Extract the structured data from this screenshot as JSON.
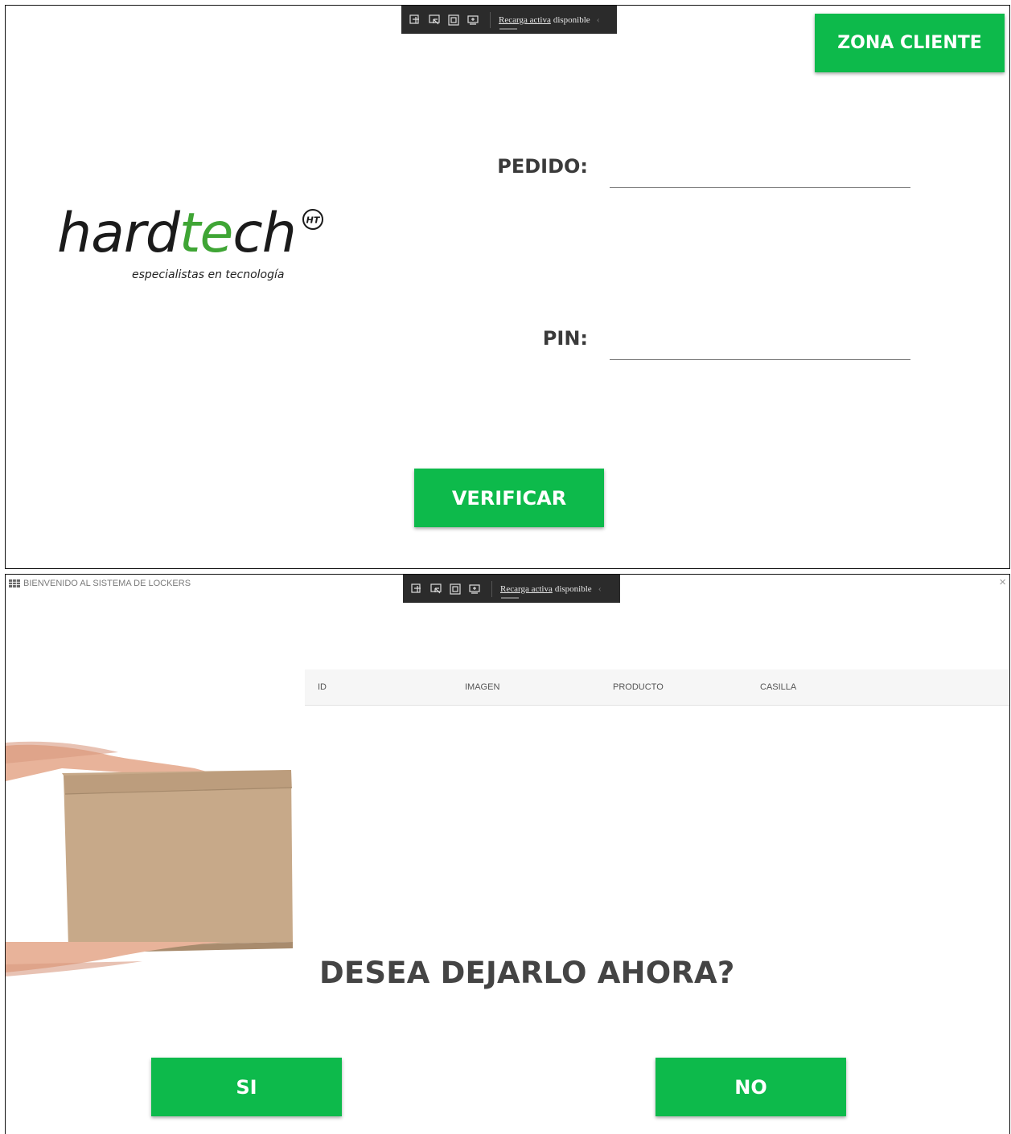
{
  "devtools_bar": {
    "link_text": "Recarga activa",
    "text": "disponible"
  },
  "login": {
    "zona_cliente_label": "ZONA CLIENTE",
    "pedido_label": "PEDIDO:",
    "pedido_value": "",
    "pin_label": "PIN:",
    "pin_value": "",
    "verificar_label": "VERIFICAR",
    "logo": {
      "word_dark": "hard",
      "word_green": "te",
      "word_end": "ch",
      "mark": "HT",
      "tagline": "especialistas en tecnología"
    }
  },
  "lockers": {
    "window_title": "BIENVENIDO AL SISTEMA DE LOCKERS",
    "close_label": "×",
    "table": {
      "columns": [
        "ID",
        "IMAGEN",
        "PRODUCTO",
        "CASILLA"
      ],
      "rows": []
    },
    "question": "DESEA DEJARLO AHORA?",
    "yes_label": "SI",
    "no_label": "NO"
  },
  "colors": {
    "accent_green": "#0dba4b",
    "logo_green": "#3fa535",
    "devbar_bg": "#2b2b2b"
  },
  "icons": [
    "live-tree-icon",
    "select-element-icon",
    "display-layout-icon",
    "track-focus-icon",
    "app-grid-icon",
    "close-icon"
  ]
}
